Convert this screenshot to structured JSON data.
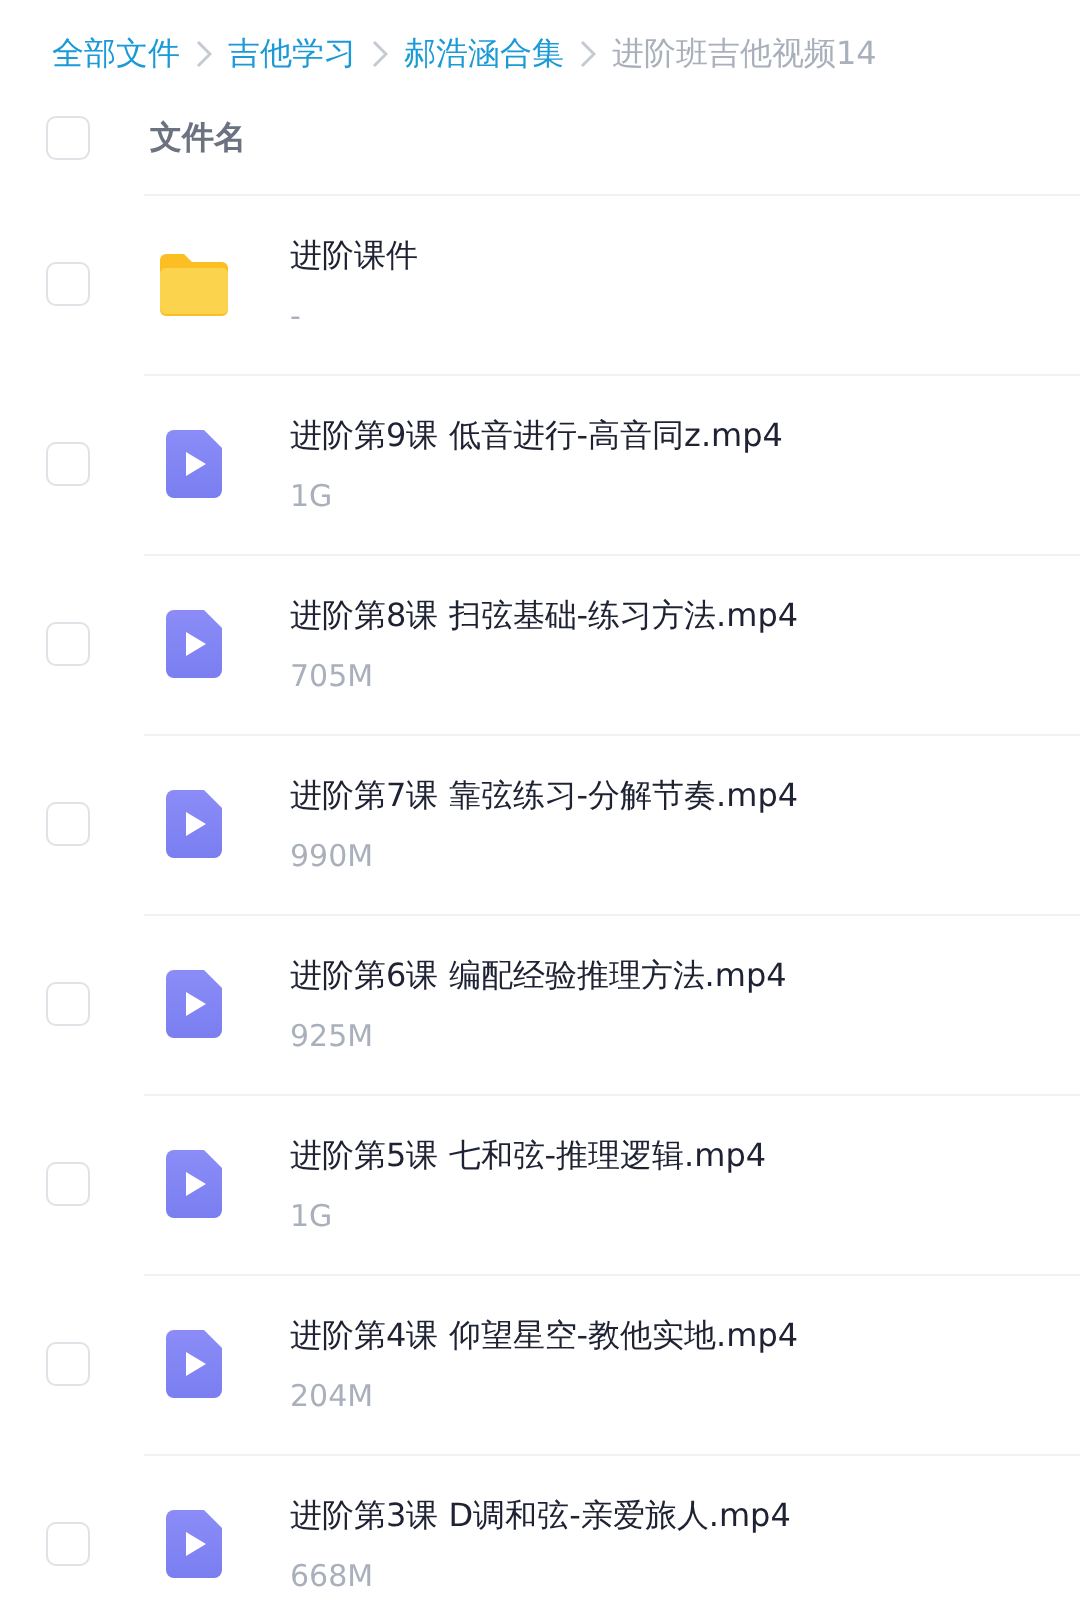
{
  "breadcrumb": [
    {
      "label": "全部文件",
      "current": false
    },
    {
      "label": "吉他学习",
      "current": false
    },
    {
      "label": "郝浩涵合集",
      "current": false
    },
    {
      "label": "进阶班吉他视频14",
      "current": true
    }
  ],
  "table": {
    "header": {
      "label": "文件名",
      "checked": false
    },
    "rows": [
      {
        "kind": "folder",
        "name": "进阶课件",
        "size": "-",
        "checked": false
      },
      {
        "kind": "video",
        "name": "进阶第9课 低音进行-高音同z.mp4",
        "size": "1G",
        "checked": false
      },
      {
        "kind": "video",
        "name": "进阶第8课 扫弦基础-练习方法.mp4",
        "size": "705M",
        "checked": false
      },
      {
        "kind": "video",
        "name": "进阶第7课 靠弦练习-分解节奏.mp4",
        "size": "990M",
        "checked": false
      },
      {
        "kind": "video",
        "name": "进阶第6课 编配经验推理方法.mp4",
        "size": "925M",
        "checked": false
      },
      {
        "kind": "video",
        "name": "进阶第5课 七和弦-推理逻辑.mp4",
        "size": "1G",
        "checked": false
      },
      {
        "kind": "video",
        "name": "进阶第4课 仰望星空-教他实地.mp4",
        "size": "204M",
        "checked": false
      },
      {
        "kind": "video",
        "name": "进阶第3课 D调和弦-亲爱旅人.mp4",
        "size": "668M",
        "checked": false
      }
    ]
  }
}
